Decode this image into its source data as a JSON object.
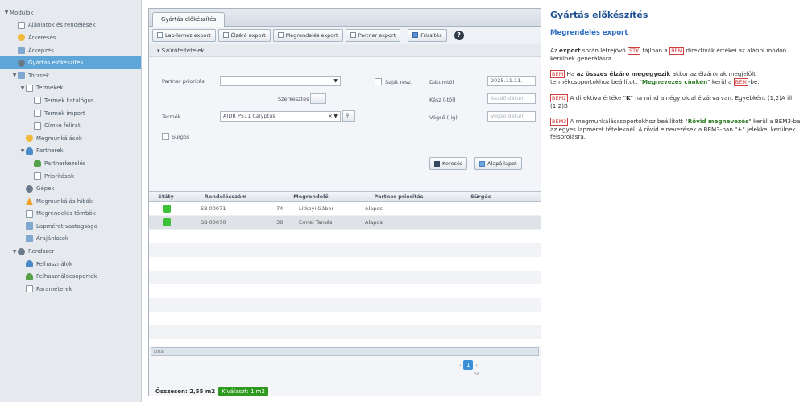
{
  "sidebar": {
    "items": [
      {
        "label": "Modulok",
        "indent": 0,
        "toggle": "▼",
        "icon": "none"
      },
      {
        "label": "Ajánlatok és rendelések",
        "indent": 1,
        "toggle": "",
        "icon": "doc"
      },
      {
        "label": "Árkeresés",
        "indent": 1,
        "toggle": "",
        "icon": "star"
      },
      {
        "label": "Árképzés",
        "indent": 1,
        "toggle": "",
        "icon": "grid"
      },
      {
        "label": "Gyártás előkészítés",
        "indent": 1,
        "toggle": "",
        "icon": "gear",
        "selected": true
      },
      {
        "label": "Törzsek",
        "indent": 1,
        "toggle": "▼",
        "icon": "grid"
      },
      {
        "label": "Termékek",
        "indent": 2,
        "toggle": "▼",
        "icon": "doc"
      },
      {
        "label": "Termék katalógus",
        "indent": 3,
        "toggle": "",
        "icon": "doc"
      },
      {
        "label": "Termék import",
        "indent": 3,
        "toggle": "",
        "icon": "doc"
      },
      {
        "label": "Címke felirat",
        "indent": 3,
        "toggle": "",
        "icon": "doc"
      },
      {
        "label": "Megmunkálások",
        "indent": 2,
        "toggle": "",
        "icon": "star"
      },
      {
        "label": "Partnerek",
        "indent": 2,
        "toggle": "▼",
        "icon": "person"
      },
      {
        "label": "Partnerkezelés",
        "indent": 3,
        "toggle": "",
        "icon": "person2"
      },
      {
        "label": "Prioritások",
        "indent": 3,
        "toggle": "",
        "icon": "doc"
      },
      {
        "label": "Gépek",
        "indent": 2,
        "toggle": "",
        "icon": "gear"
      },
      {
        "label": "Megmunkálás hibák",
        "indent": 2,
        "toggle": "",
        "icon": "warn"
      },
      {
        "label": "Megrendelés tömbök",
        "indent": 2,
        "toggle": "",
        "icon": "doc"
      },
      {
        "label": "Lapméret vastagsága",
        "indent": 2,
        "toggle": "",
        "icon": "grid"
      },
      {
        "label": "Árajánlatok",
        "indent": 2,
        "toggle": "",
        "icon": "grid"
      },
      {
        "label": "Rendszer",
        "indent": 1,
        "toggle": "▼",
        "icon": "gear"
      },
      {
        "label": "Felhasználók",
        "indent": 2,
        "toggle": "",
        "icon": "person"
      },
      {
        "label": "Felhasználócsoportok",
        "indent": 2,
        "toggle": "",
        "icon": "person2"
      },
      {
        "label": "Paraméterek",
        "indent": 2,
        "toggle": "",
        "icon": "doc"
      }
    ]
  },
  "main": {
    "tab_label": "Gyártás előkészítés",
    "toolbar": [
      {
        "label": "Lap-lemez export"
      },
      {
        "label": "Élzáró export"
      },
      {
        "label": "Megrendelés export"
      },
      {
        "label": "Partner export"
      },
      {
        "label": "Frissítés"
      }
    ],
    "help_glyph": "?",
    "filter_title": "Szűrőfeltételek",
    "filters": {
      "partner_priority_label": "Partner prioritás",
      "szerkesztes_label": "Szerkesztés",
      "sajat_label": "Saját rész.",
      "datum_label": "Dátumtól",
      "datum_value": "2025.11.11.",
      "kezdo_label": "Kész (-tól)",
      "kezdo_placeholder": "Kezdő dátum",
      "vegso_label": "Végső (-ig)",
      "vegso_placeholder": "Végső dátum",
      "termek_label": "Termék",
      "termek_value": "AIDR P511 Calyptus",
      "sorolas_label": "Sürgős",
      "search_button": "Keresés",
      "reset_button": "Alapállapot"
    },
    "grid": {
      "headers": [
        "Státy",
        "Rendelésszám",
        "Megrendelő",
        "Partner prioritás",
        "Sürgős"
      ],
      "rows": [
        {
          "order": "SB 00071",
          "customer_code": "74",
          "customer": "Litkeyi Gábor",
          "priority": "Alapos",
          "selected": false
        },
        {
          "order": "SB 00070",
          "customer_code": "38",
          "customer": "Ermei Tamás",
          "priority": "Alapos",
          "selected": true
        }
      ]
    },
    "scroll_label": "Lista",
    "pager": {
      "prev": "‹",
      "current": "1",
      "next": "›",
      "size": "50"
    },
    "footer": {
      "summary": "Összesen: 2,55 m2",
      "badge": "Kiválaszt: 1 m2"
    }
  },
  "help": {
    "title": "Gyártás előkészítés",
    "subtitle": "Megrendelés export",
    "p1": {
      "a": "Az ",
      "b": "export",
      "c": " során létrejövő ",
      "tag1": "STK",
      "d": " fájlban a ",
      "tag2": "BEM",
      "e": " direktívák értékei az alábbi módon kerülnek generálásra."
    },
    "p2": {
      "tag": "BEM",
      "a": " Ha ",
      "b": "az összes élzáró megegyezik",
      "c": " akkor az élzárónak megjelölt termékcsoportokhoz beállított \"",
      "d": "Megnevezés címkén",
      "e": "\" kerül a ",
      "tag2": "BEM",
      "f": "-be."
    },
    "p3": {
      "tag": "BEM2",
      "a": " A direktíva értéke \"",
      "b": "K",
      "c": "\" ha mind a négy oldal élzárva van. Egyébként (1,2)A ill. (1,2)B"
    },
    "p4": {
      "tag": "BEM3",
      "a": " A megmunkáláscsoportokhoz beállított \"",
      "b": "Rövid megnevezés",
      "c": "\" kerül a BEM3-ba az egyes lapméret tételeknél. A rövid elnevezések a BEM3-ban \"+\" jelekkel kerülnek felsorolásra."
    }
  }
}
